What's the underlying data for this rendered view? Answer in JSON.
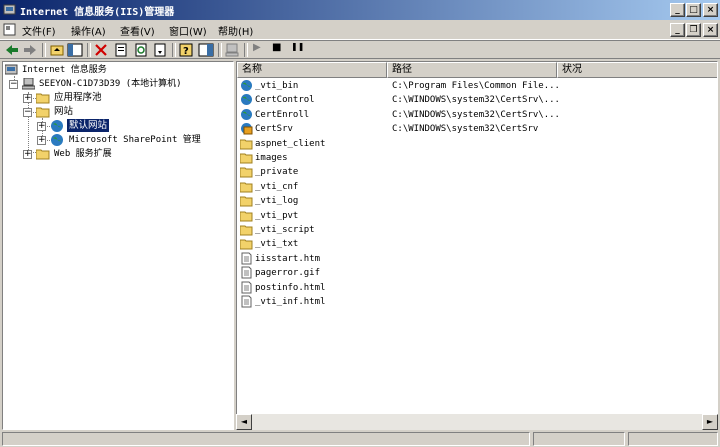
{
  "window": {
    "title": "Internet 信息服务(IIS)管理器",
    "controls": {
      "minimize": "_",
      "maximize": "□",
      "close": "×"
    },
    "child_controls": {
      "minimize": "_",
      "restore": "❐",
      "close": "×"
    }
  },
  "menu": [
    {
      "label": "文件(F)"
    },
    {
      "label": "操作(A)"
    },
    {
      "label": "查看(V)"
    },
    {
      "label": "窗口(W)"
    },
    {
      "label": "帮助(H)"
    }
  ],
  "toolbar": {
    "icons": [
      "back-icon",
      "forward-icon",
      "up-icon",
      "show-tree-icon",
      "delete-icon",
      "properties-icon",
      "refresh-icon",
      "export-list-icon",
      "help-icon",
      "show-hide-icon",
      "computer-icon",
      "play-icon",
      "stop-icon",
      "pause-icon"
    ],
    "play": "▶",
    "stop": "■",
    "pause": "❚❚"
  },
  "tree": {
    "root": "Internet 信息服务",
    "computer": "SEEYON-C1D73D39 (本地计算机)",
    "items": {
      "app_pools": "应用程序池",
      "websites": "网站",
      "default_site": "默认网站",
      "sharepoint": "Microsoft SharePoint 管理",
      "web_ext": "Web 服务扩展"
    },
    "expanders": {
      "plus": "+",
      "minus": "−"
    }
  },
  "list": {
    "columns": [
      "名称",
      "路径",
      "状况"
    ],
    "rows": [
      {
        "name": "_vti_bin",
        "path": "C:\\Program Files\\Common File...",
        "icon": "globe-icon"
      },
      {
        "name": "CertControl",
        "path": "C:\\WINDOWS\\system32\\CertSrv\\...",
        "icon": "globe-icon"
      },
      {
        "name": "CertEnroll",
        "path": "C:\\WINDOWS\\system32\\CertSrv\\...",
        "icon": "globe-icon"
      },
      {
        "name": "CertSrv",
        "path": "C:\\WINDOWS\\system32\\CertSrv",
        "icon": "package-icon"
      },
      {
        "name": "aspnet_client",
        "path": "",
        "icon": "folder-icon"
      },
      {
        "name": "images",
        "path": "",
        "icon": "folder-icon"
      },
      {
        "name": "_private",
        "path": "",
        "icon": "folder-icon"
      },
      {
        "name": "_vti_cnf",
        "path": "",
        "icon": "folder-icon"
      },
      {
        "name": "_vti_log",
        "path": "",
        "icon": "folder-icon"
      },
      {
        "name": "_vti_pvt",
        "path": "",
        "icon": "folder-icon"
      },
      {
        "name": "_vti_script",
        "path": "",
        "icon": "folder-icon"
      },
      {
        "name": "_vti_txt",
        "path": "",
        "icon": "folder-icon"
      },
      {
        "name": "iisstart.htm",
        "path": "",
        "icon": "file-icon"
      },
      {
        "name": "pagerror.gif",
        "path": "",
        "icon": "file-icon"
      },
      {
        "name": "postinfo.html",
        "path": "",
        "icon": "file-icon"
      },
      {
        "name": "_vti_inf.html",
        "path": "",
        "icon": "file-icon"
      }
    ]
  },
  "scrollbar": {
    "left": "◄",
    "right": "►"
  },
  "colors": {
    "titlebar_start": "#0a246a",
    "titlebar_end": "#a6caf0",
    "selection": "#0a246a",
    "face": "#d4d0c8"
  }
}
